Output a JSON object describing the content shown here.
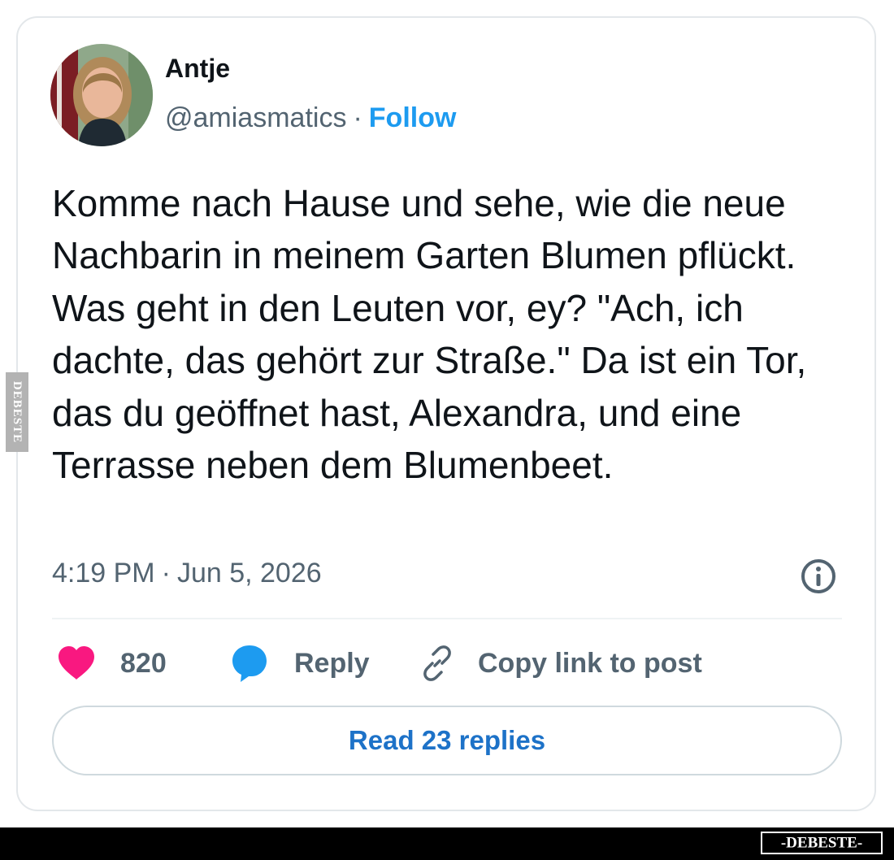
{
  "tweet": {
    "author_name": "Antje",
    "handle": "@amiasmatics",
    "separator": "·",
    "follow_label": "Follow",
    "text": "Komme nach Hause und sehe, wie die neue Nachbarin in meinem Garten Blumen pflückt. Was geht in den Leuten vor, ey? \"Ach, ich dachte, das gehört zur Straße.\" Da ist ein Tor, das du geöffnet hast, Alexandra, und eine Terrasse neben dem Blumenbeet.",
    "time": "4:19 PM",
    "date": "Jun 5, 2026",
    "info_icon": "info-icon"
  },
  "actions": {
    "like_count": "820",
    "like_icon": "heart-icon",
    "reply_label": "Reply",
    "reply_icon": "speech-bubble-icon",
    "copy_label": "Copy link to post",
    "copy_icon": "link-icon"
  },
  "read_replies_label": "Read 23 replies",
  "watermark": {
    "side_text": "DEBESTE",
    "footer_text": "-DEBESTE-"
  },
  "colors": {
    "accent": "#1d9bf0",
    "like": "#f91880",
    "reply_icon": "#1d9bf0",
    "secondary_text": "#536471",
    "primary_text": "#0f1419"
  }
}
